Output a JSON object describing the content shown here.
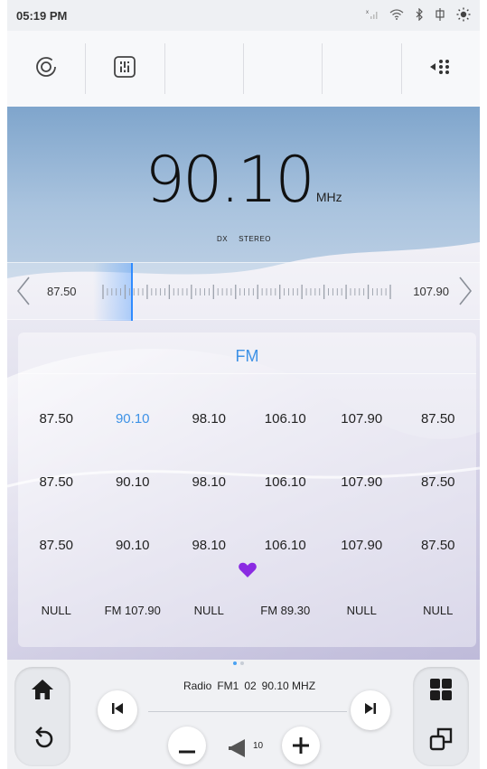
{
  "status_bar": {
    "time": "05:19 PM"
  },
  "toolbar": {
    "icons": [
      "radio-wave-icon",
      "equalizer-icon",
      "",
      "",
      "",
      "menu-dots-icon"
    ]
  },
  "tuner": {
    "frequency": "90.10",
    "unit": "MHz",
    "flags": [
      "DX",
      "STEREO"
    ],
    "range_low": "87.50",
    "range_high": "107.90",
    "needle_position": 0.13
  },
  "presets": {
    "band": "FM",
    "rows": [
      [
        "87.50",
        "90.10",
        "98.10",
        "106.10",
        "107.90",
        "87.50"
      ],
      [
        "87.50",
        "90.10",
        "98.10",
        "106.10",
        "107.90",
        "87.50"
      ],
      [
        "87.50",
        "90.10",
        "98.10",
        "106.10",
        "107.90",
        "87.50"
      ]
    ],
    "active": {
      "row": 0,
      "col": 1
    },
    "names": [
      "NULL",
      "FM 107.90",
      "NULL",
      "FM 89.30",
      "NULL",
      "NULL"
    ]
  },
  "now_playing": {
    "source": "Radio",
    "band": "FM1",
    "preset": "02",
    "frequency": "90.10 MHZ"
  },
  "volume": {
    "level": "10"
  },
  "pager": {
    "count": 2,
    "active": 0
  },
  "colors": {
    "accent": "#3e92e6",
    "favorite": "#8a2be2"
  }
}
